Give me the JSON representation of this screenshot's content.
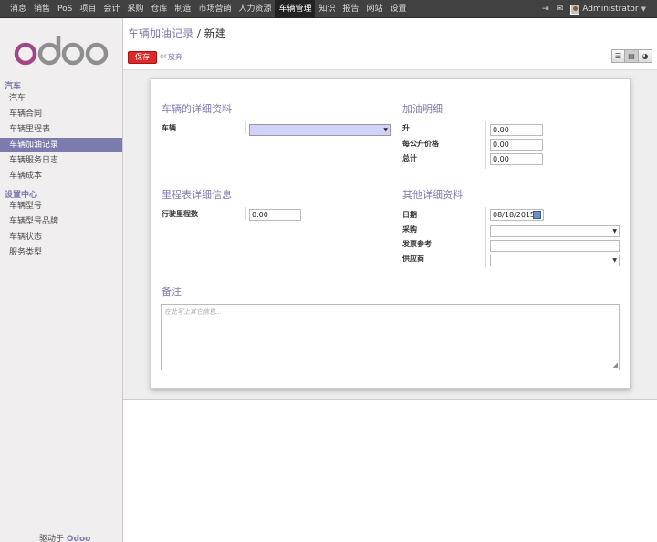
{
  "topbar": {
    "menu": [
      "消息",
      "销售",
      "PoS",
      "项目",
      "会计",
      "采购",
      "仓库",
      "制造",
      "市场营销",
      "人力资源",
      "车辆管理",
      "知识",
      "报告",
      "网站",
      "设置"
    ],
    "active_index": 10,
    "user_name": "Administrator"
  },
  "sidebar": {
    "sections": [
      {
        "title": "汽车",
        "items": [
          "汽车",
          "车辆合同",
          "车辆里程表",
          "车辆加油记录",
          "车辆服务日志",
          "车辆成本"
        ]
      },
      {
        "title": "设置中心",
        "items": [
          "车辆型号",
          "车辆型号品牌",
          "车辆状态",
          "服务类型"
        ]
      }
    ],
    "active_item": "车辆加油记录",
    "powered_prefix": "驱动于",
    "powered_brand": "Odoo"
  },
  "header": {
    "breadcrumb_link": "车辆加油记录",
    "breadcrumb_sep": "/",
    "breadcrumb_current": "新建",
    "save_label": "保存",
    "or_text": "or",
    "discard_label": "放弃"
  },
  "form": {
    "vehicle_section": "车辆的详细资料",
    "vehicle_label": "车辆",
    "vehicle_value": "",
    "refuel_section": "加油明细",
    "liter_label": "升",
    "liter_value": "0.00",
    "price_label": "每公升价格",
    "price_value": "0.00",
    "total_label": "总计",
    "total_value": "0.00",
    "odometer_section": "里程表详细信息",
    "odometer_label": "行驶里程数",
    "odometer_value": "0.00",
    "other_section": "其他详细资料",
    "date_label": "日期",
    "date_value": "08/18/2015",
    "purchaser_label": "采购",
    "purchaser_value": "",
    "invoice_label": "发票参考",
    "invoice_value": "",
    "vendor_label": "供应商",
    "vendor_value": "",
    "notes_section": "备注",
    "notes_placeholder": "在此写上其它信息..."
  },
  "colors": {
    "accent": "#7c7bad",
    "save_button": "#dc2a2a",
    "topbar": "#414141",
    "sidebar": "#f0eeee"
  }
}
